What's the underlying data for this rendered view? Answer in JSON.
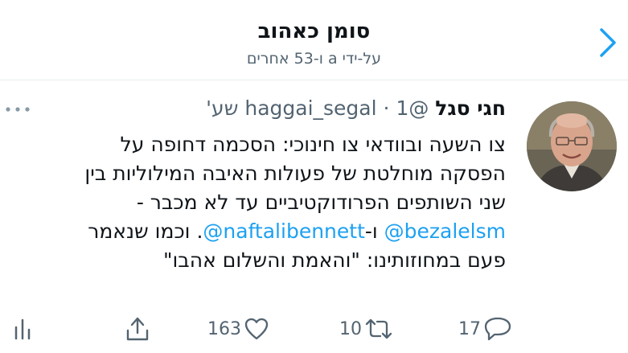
{
  "header": {
    "title": "סומן כאהוב",
    "subtitle": "על-ידי a ו-53 אחרים"
  },
  "tweet": {
    "author_name": "חגי סגל",
    "handle": "@haggai_segal",
    "separator": "·",
    "time": "1 שע'",
    "lines": [
      "צו השעה ובוודאי צו חינוכי: הסכמה דחופה על",
      "הפסקה מוחלטת של פעולות האיבה המילוליות בין",
      "שני השותפים הפרודוקטיביים עד לא מכבר -"
    ],
    "line4": {
      "mention1": "@bezalelsm",
      "conj": " ו-",
      "mention2": "@naftalibennett",
      "rest": ".  וכמו שנאמר"
    },
    "line5": "פעם במחוזותינו: \"והאמת והשלום אהבו\""
  },
  "actions": {
    "replies": "17",
    "retweets": "10",
    "likes": "163"
  },
  "icons": {
    "back": "chevron-right-icon",
    "more": "more-dots-icon",
    "reply": "reply-icon",
    "retweet": "retweet-icon",
    "like": "heart-icon",
    "share": "share-icon",
    "analytics": "analytics-icon"
  },
  "colors": {
    "accent": "#1da1f2",
    "secondary_text": "#536471"
  }
}
